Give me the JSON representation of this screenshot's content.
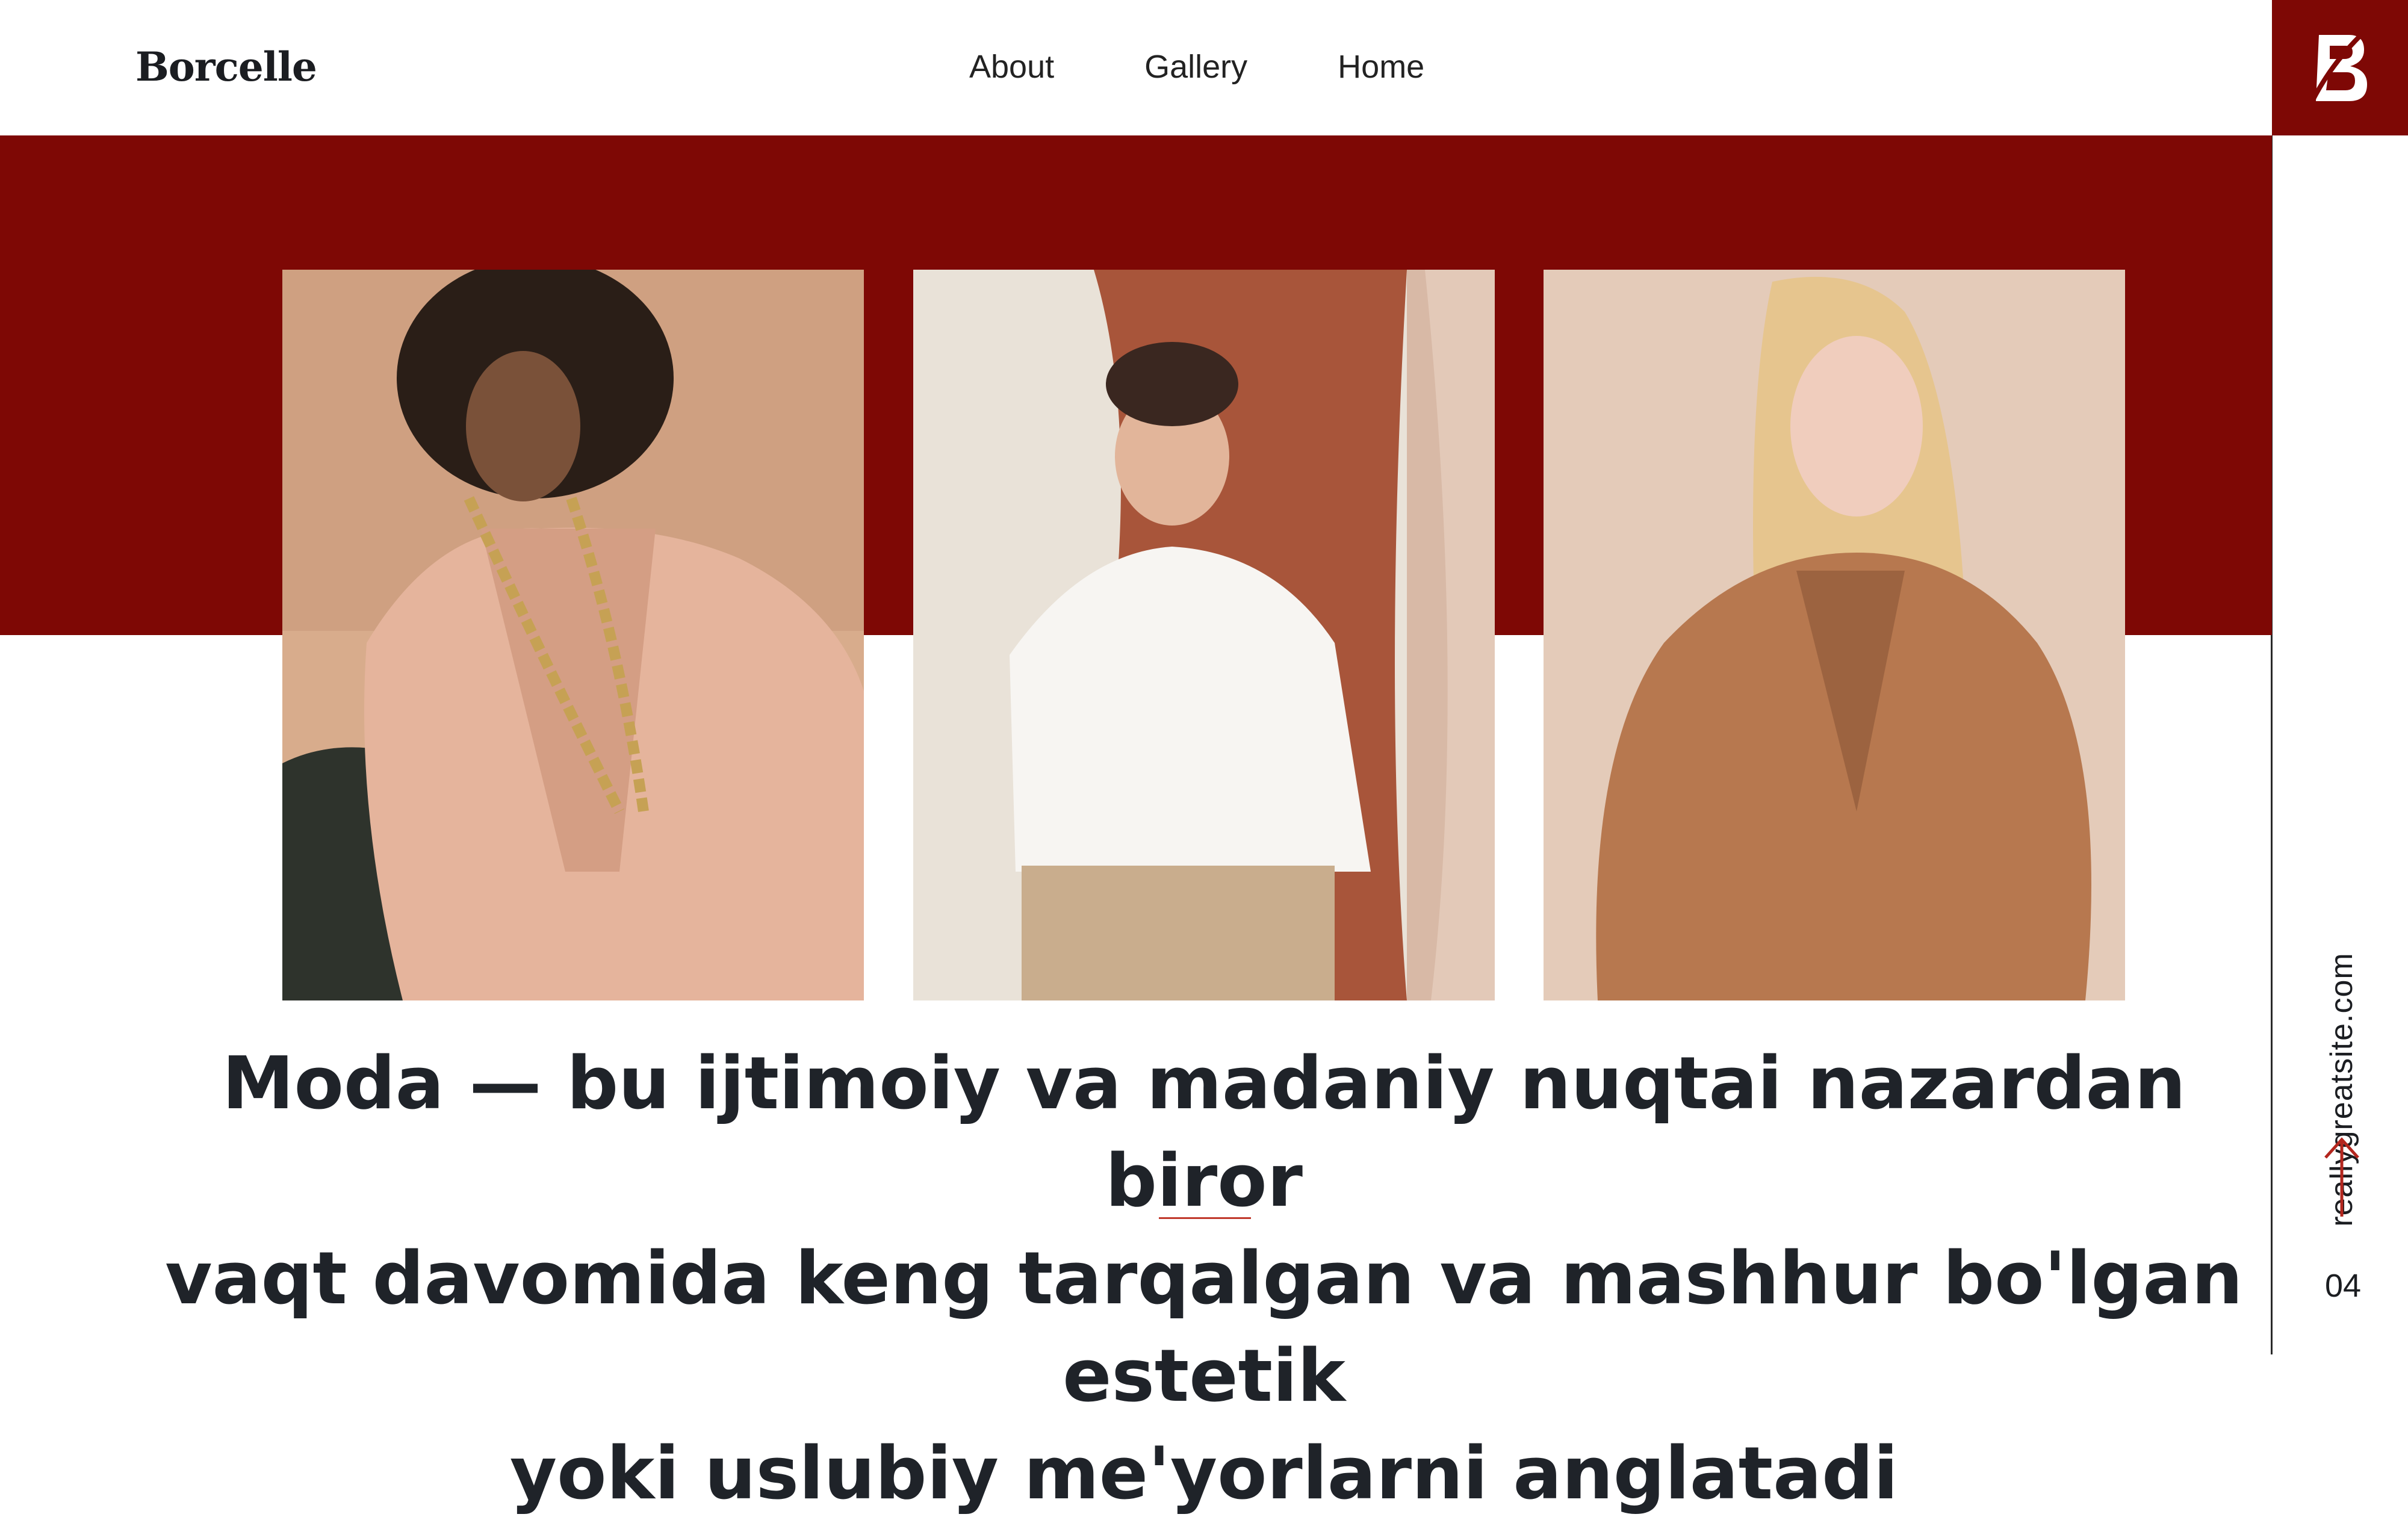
{
  "brand": "Borcelle",
  "nav": {
    "items": [
      "About",
      "Gallery",
      "Home"
    ]
  },
  "logo": {
    "icon": "borcelle-b-logo-icon",
    "letter": "B"
  },
  "gallery": {
    "photos": [
      {
        "subject": "woman-curly-hair-pink-blazer-gold-chain"
      },
      {
        "subject": "woman-white-blouse-draped-fabric"
      },
      {
        "subject": "woman-blonde-camel-coat"
      }
    ]
  },
  "headline": {
    "line1": "Moda — bu ijtimoiy va madaniy nuqtai nazardan biror",
    "line2": "vaqt davomida keng tarqalgan va mashhur bo'lgan estetik",
    "line3": "yoki uslubiy me'yorlarni anglatadi"
  },
  "sidebar": {
    "url": "reallygreatsite.com",
    "arrow_icon": "arrow-up-icon",
    "page_number": "04"
  },
  "colors": {
    "accent": "#7e0805",
    "text": "#1f2329",
    "background": "#ffffff"
  }
}
